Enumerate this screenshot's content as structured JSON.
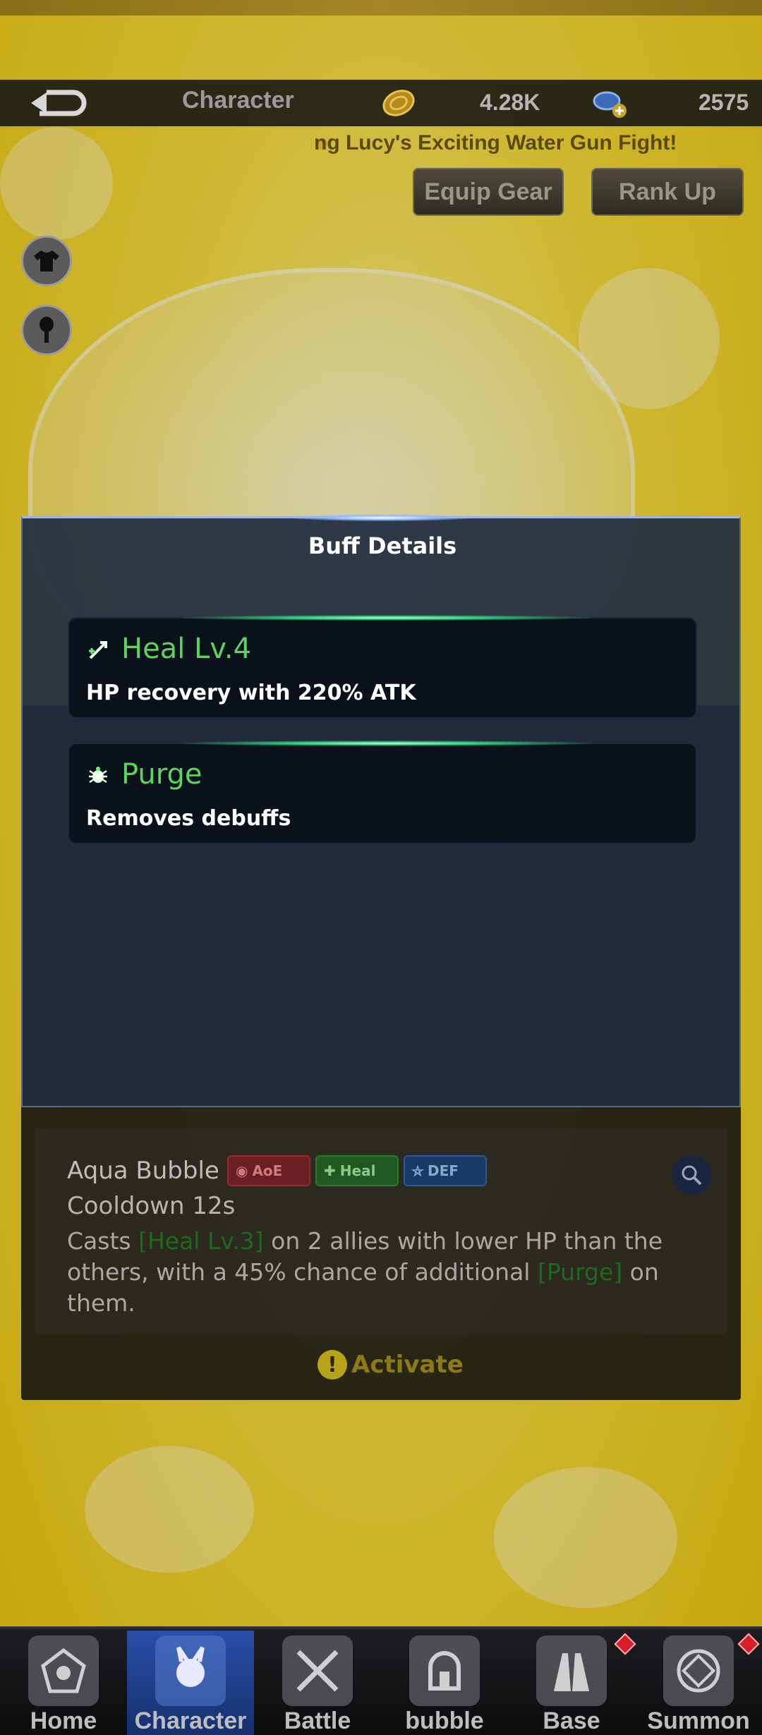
{
  "header": {
    "title": "Character",
    "coins": "4.28K",
    "gems": "2575"
  },
  "marquee": "ng Lucy's Exciting Water Gun Fight!",
  "actions": {
    "equip_gear": "Equip Gear",
    "rank_up": "Rank Up"
  },
  "skill": {
    "name": "Aqua Bubble",
    "tags": [
      "AoE",
      "Heal",
      "DEF"
    ],
    "cooldown": "Cooldown 12s",
    "desc_1": "Casts ",
    "desc_hl_1": "[Heal Lv.3]",
    "desc_2": " on 2 allies with lower HP than the others, with a 45% chance of additional ",
    "desc_hl_2": "[Purge]",
    "desc_3": " on them.",
    "activate": "Activate"
  },
  "modal": {
    "title": "Buff Details",
    "buffs": [
      {
        "name": "Heal Lv.4",
        "desc": "HP recovery with 220% ATK",
        "icon": "heal-icon"
      },
      {
        "name": "Purge",
        "desc": "Removes debuffs",
        "icon": "purge-icon"
      }
    ]
  },
  "nav": {
    "items": [
      {
        "label": "Home",
        "icon": "home-icon"
      },
      {
        "label": "Character",
        "icon": "character-icon"
      },
      {
        "label": "Battle",
        "icon": "battle-icon"
      },
      {
        "label": "bubble",
        "icon": "bubble-icon"
      },
      {
        "label": "Base",
        "icon": "base-icon"
      },
      {
        "label": "Summon",
        "icon": "summon-icon"
      }
    ]
  },
  "colors": {
    "accent_green": "#5fd35f",
    "modal_bg": "#222c40",
    "nav_active": "#2b4fa8",
    "badge_red": "#d81e2a"
  }
}
